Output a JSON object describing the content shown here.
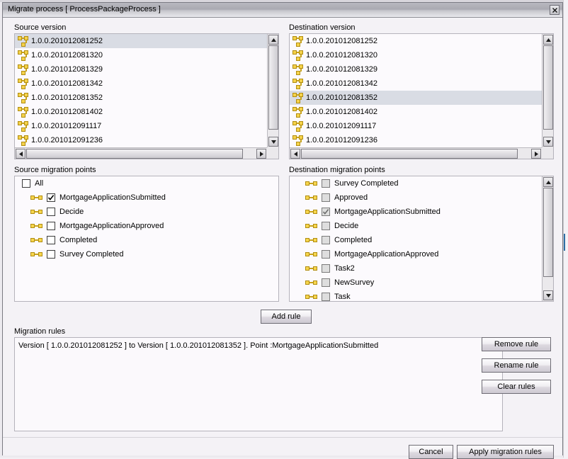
{
  "window": {
    "title": "Migrate process [ ProcessPackageProcess ]",
    "close_icon": "close-icon"
  },
  "source_version": {
    "label": "Source version",
    "items": [
      {
        "name": "1.0.0.201012081252",
        "selected": true
      },
      {
        "name": "1.0.0.201012081320",
        "selected": false
      },
      {
        "name": "1.0.0.201012081329",
        "selected": false
      },
      {
        "name": "1.0.0.201012081342",
        "selected": false
      },
      {
        "name": "1.0.0.201012081352",
        "selected": false
      },
      {
        "name": "1.0.0.201012081402",
        "selected": false
      },
      {
        "name": "1.0.0.201012091117",
        "selected": false
      },
      {
        "name": "1.0.0.201012091236",
        "selected": false
      }
    ]
  },
  "destination_version": {
    "label": "Destination version",
    "items": [
      {
        "name": "1.0.0.201012081252",
        "selected": false
      },
      {
        "name": "1.0.0.201012081320",
        "selected": false
      },
      {
        "name": "1.0.0.201012081329",
        "selected": false
      },
      {
        "name": "1.0.0.201012081342",
        "selected": false
      },
      {
        "name": "1.0.0.201012081352",
        "selected": true
      },
      {
        "name": "1.0.0.201012081402",
        "selected": false
      },
      {
        "name": "1.0.0.201012091117",
        "selected": false
      },
      {
        "name": "1.0.0.201012091236",
        "selected": false
      }
    ]
  },
  "source_points": {
    "label": "Source migration points",
    "all_label": "All",
    "all_checked": false,
    "items": [
      {
        "name": "MortgageApplicationSubmitted",
        "checked": true
      },
      {
        "name": "Decide",
        "checked": false
      },
      {
        "name": "MortgageApplicationApproved",
        "checked": false
      },
      {
        "name": "Completed",
        "checked": false
      },
      {
        "name": "Survey Completed",
        "checked": false
      }
    ]
  },
  "destination_points": {
    "label": "Destination migration points",
    "items": [
      {
        "name": "Survey Completed",
        "checked": false
      },
      {
        "name": "Approved",
        "checked": false
      },
      {
        "name": "MortgageApplicationSubmitted",
        "checked": true
      },
      {
        "name": "Decide",
        "checked": false
      },
      {
        "name": "Completed",
        "checked": false
      },
      {
        "name": "MortgageApplicationApproved",
        "checked": false
      },
      {
        "name": "Task2",
        "checked": false
      },
      {
        "name": "NewSurvey",
        "checked": false
      },
      {
        "name": "Task",
        "checked": false
      }
    ]
  },
  "add_rule_button": "Add rule",
  "migration_rules": {
    "label": "Migration rules",
    "rules": [
      "Version [ 1.0.0.201012081252 ] to Version [ 1.0.0.201012081352 ]. Point :MortgageApplicationSubmitted"
    ]
  },
  "rule_actions": {
    "remove": "Remove rule",
    "rename": "Rename rule",
    "clear": "Clear rules"
  },
  "footer": {
    "cancel": "Cancel",
    "apply": "Apply migration rules"
  },
  "colors": {
    "node_fill": "#f5d24a",
    "node_stroke": "#b08c10",
    "selection": "#d9dce4",
    "dialog_bg": "#f4f2f6",
    "panel_bg": "#fbf9fc"
  }
}
